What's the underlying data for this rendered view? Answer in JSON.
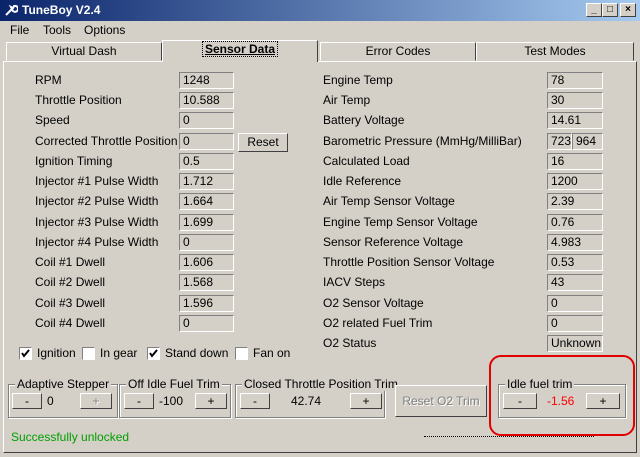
{
  "window": {
    "title": "TuneBoy V2.4"
  },
  "menu": [
    "File",
    "Tools",
    "Options"
  ],
  "tabs": [
    "Virtual Dash",
    "Sensor Data",
    "Error Codes",
    "Test Modes"
  ],
  "left_params": [
    {
      "label": "RPM",
      "value": "1248"
    },
    {
      "label": "Throttle Position",
      "value": "10.588"
    },
    {
      "label": "Speed",
      "value": "0"
    },
    {
      "label": "Corrected Throttle Position",
      "value": "0"
    },
    {
      "label": "Ignition Timing",
      "value": "0.5"
    },
    {
      "label": "Injector #1 Pulse Width",
      "value": "1.712"
    },
    {
      "label": "Injector #2 Pulse Width",
      "value": "1.664"
    },
    {
      "label": "Injector #3 Pulse Width",
      "value": "1.699"
    },
    {
      "label": "Injector #4 Pulse Width",
      "value": "0"
    },
    {
      "label": "Coil #1 Dwell",
      "value": "1.606"
    },
    {
      "label": "Coil #2 Dwell",
      "value": "1.568"
    },
    {
      "label": "Coil #3 Dwell",
      "value": "1.596"
    },
    {
      "label": "Coil #4 Dwell",
      "value": "0"
    }
  ],
  "reset_label": "Reset",
  "right_params": [
    {
      "label": "Engine Temp",
      "value": "78"
    },
    {
      "label": "Air Temp",
      "value": "30"
    },
    {
      "label": "Battery Voltage",
      "value": "14.61"
    },
    {
      "label": "Barometric Pressure (MmHg/MilliBar)",
      "value": "723",
      "value2": "964"
    },
    {
      "label": "Calculated Load",
      "value": "16"
    },
    {
      "label": "Idle Reference",
      "value": "1200"
    },
    {
      "label": "Air Temp Sensor Voltage",
      "value": "2.39"
    },
    {
      "label": "Engine Temp Sensor Voltage",
      "value": "0.76"
    },
    {
      "label": "Sensor Reference Voltage",
      "value": "4.983"
    },
    {
      "label": "Throttle Position Sensor Voltage",
      "value": "0.53"
    },
    {
      "label": "IACV Steps",
      "value": "43"
    },
    {
      "label": "O2 Sensor Voltage",
      "value": "0"
    },
    {
      "label": "O2 related Fuel Trim",
      "value": "0"
    },
    {
      "label": "O2 Status",
      "value": "Unknown"
    }
  ],
  "checkboxes": [
    {
      "label": "Ignition",
      "checked": true
    },
    {
      "label": "In gear",
      "checked": false
    },
    {
      "label": "Stand down",
      "checked": true
    },
    {
      "label": "Fan on",
      "checked": false
    }
  ],
  "adaptive_stepper": {
    "title": "Adaptive Stepper",
    "minus": "-",
    "value": "0",
    "plus": "+"
  },
  "off_idle_fuel_trim": {
    "title": "Off Idle Fuel Trim",
    "minus": "-",
    "value": "-100",
    "plus": "+"
  },
  "closed_throttle": {
    "title": "Closed Throttle Position Trim",
    "minus": "-",
    "value": "42.74",
    "plus": "+"
  },
  "reset_o2_label": "Reset O2 Trim",
  "idle_fuel_trim": {
    "title": "Idle fuel trim",
    "minus": "-",
    "value": "-1.56",
    "plus": "+"
  },
  "status": "Successfully unlocked",
  "colors": {
    "status_text": "#00a000",
    "idle_trim_value": "#ff0000",
    "highlight": "#e00000",
    "titlebar_start": "#0a246a",
    "titlebar_end": "#a6caf0"
  }
}
